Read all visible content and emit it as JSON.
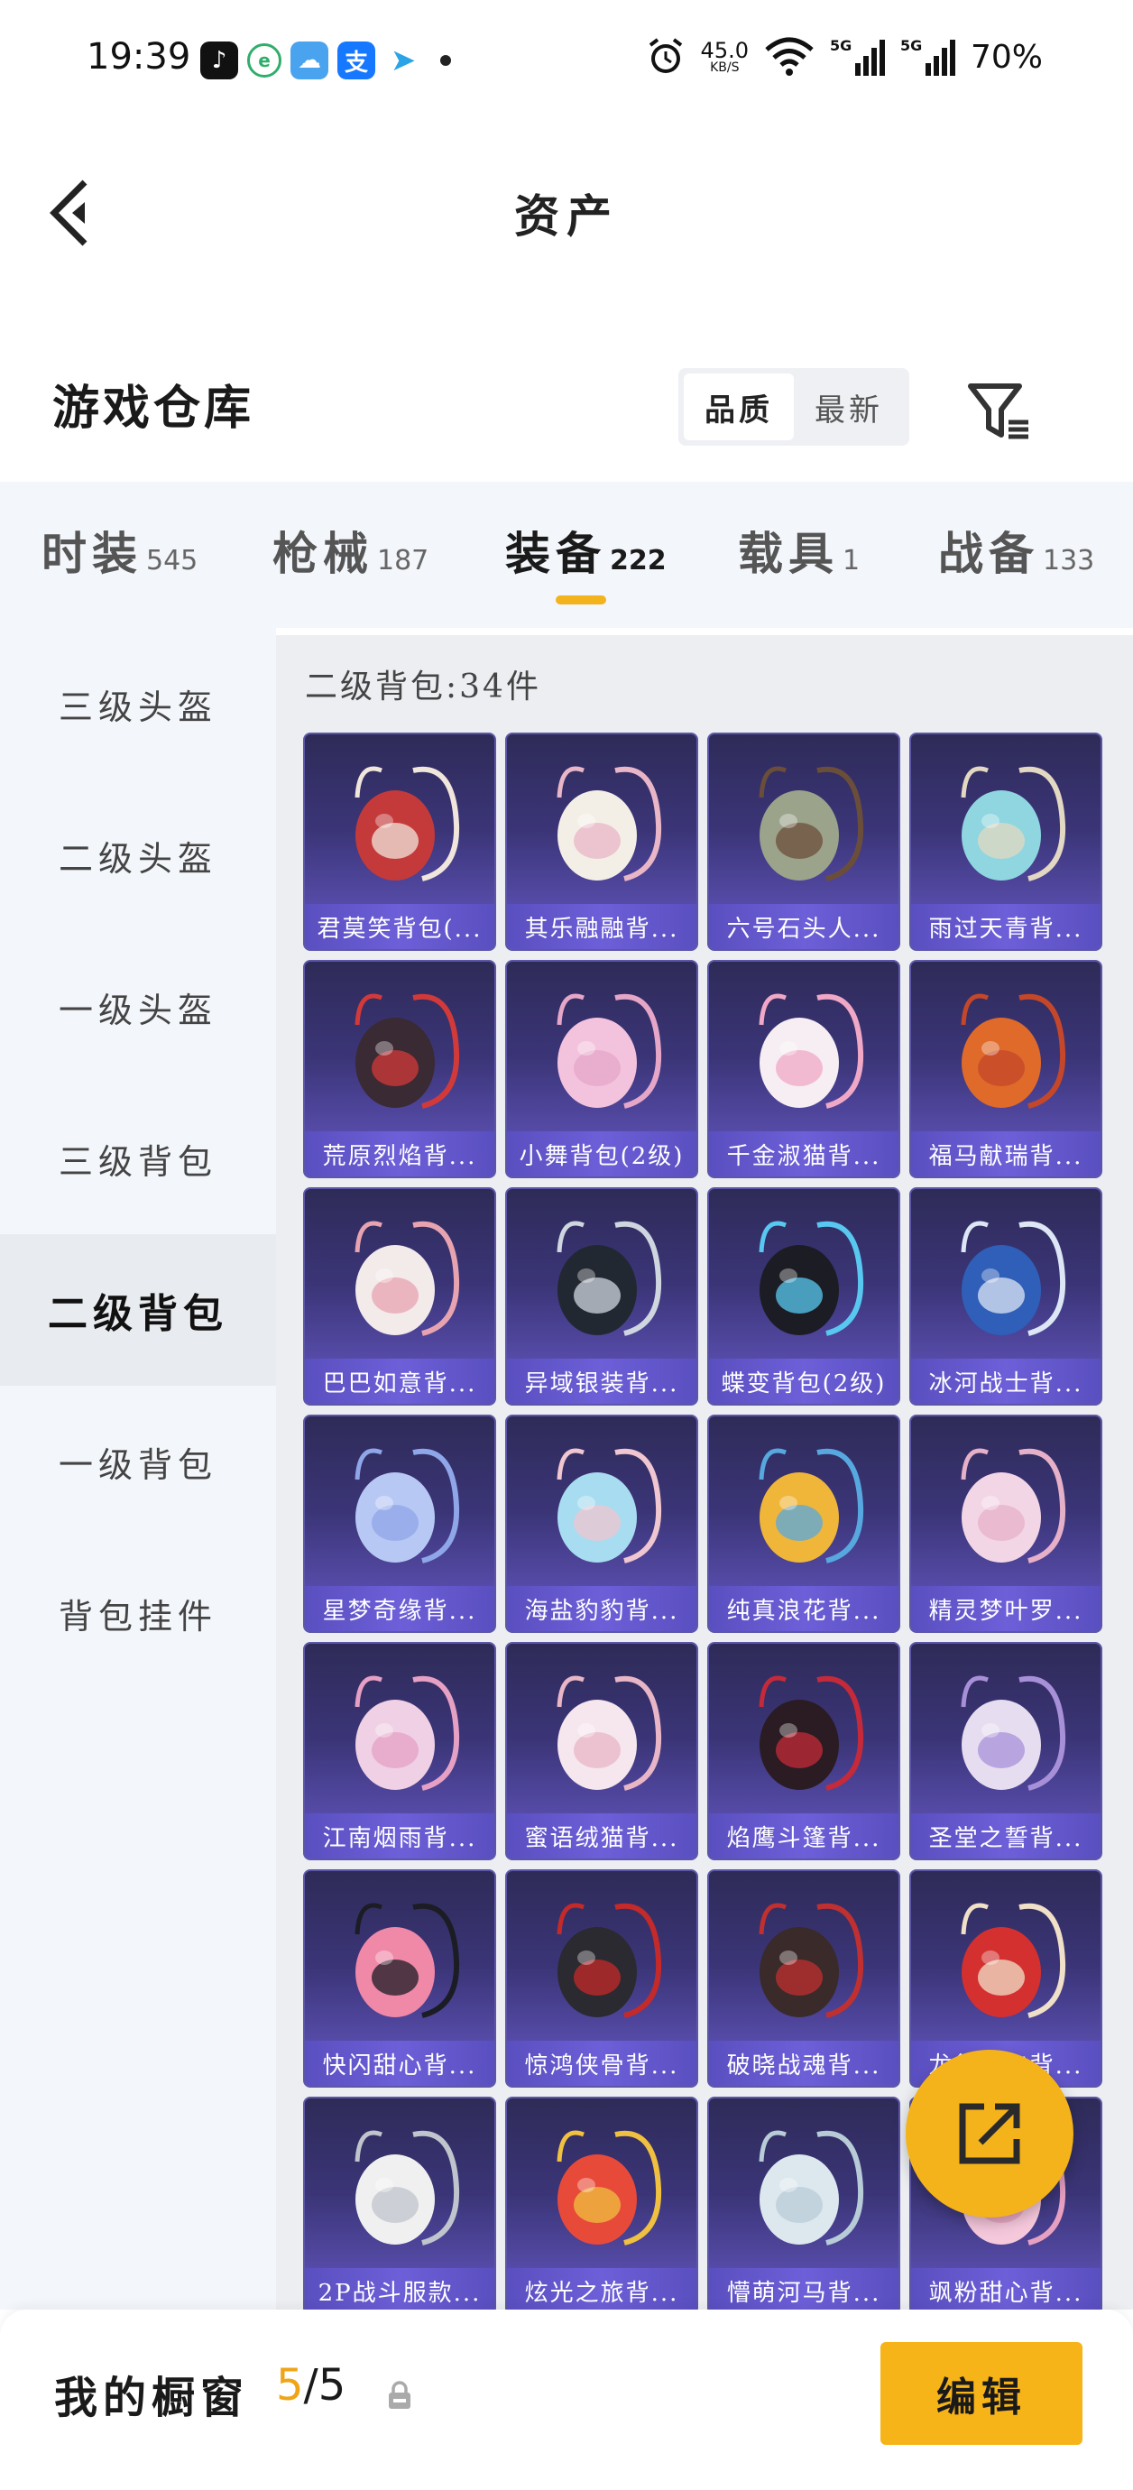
{
  "status_bar": {
    "time": "19:39",
    "net_speed": "45.0",
    "net_unit": "KB/S",
    "battery": "70%",
    "apps": [
      "tiktok-icon",
      "greenleaf-icon",
      "weather-icon",
      "alipay-icon",
      "telegram-icon"
    ]
  },
  "header": {
    "title": "资产"
  },
  "warehouse": {
    "title": "游戏仓库",
    "sort_options": [
      "品质",
      "最新"
    ],
    "active_sort": "品质"
  },
  "tabs": [
    {
      "label": "时装",
      "count": "545"
    },
    {
      "label": "枪械",
      "count": "187"
    },
    {
      "label": "装备",
      "count": "222"
    },
    {
      "label": "载具",
      "count": "1"
    },
    {
      "label": "战备",
      "count": "133"
    }
  ],
  "active_tab": "装备",
  "sidebar": {
    "items": [
      "三级头盔",
      "二级头盔",
      "一级头盔",
      "三级背包",
      "二级背包",
      "一级背包",
      "背包挂件"
    ],
    "active": "二级背包"
  },
  "panel": {
    "title": "二级背包:34件",
    "items": [
      "君莫笑背包(...",
      "其乐融融背...",
      "六号石头人...",
      "雨过天青背...",
      "荒原烈焰背...",
      "小舞背包(2级)",
      "千金淑猫背...",
      "福马献瑞背...",
      "巴巴如意背...",
      "异域银装背...",
      "蝶变背包(2级)",
      "冰河战士背...",
      "星梦奇缘背...",
      "海盐豹豹背...",
      "纯真浪花背...",
      "精灵梦叶罗...",
      "江南烟雨背...",
      "蜜语绒猫背...",
      "焰鹰斗篷背...",
      "圣堂之誓背...",
      "快闪甜心背...",
      "惊鸿侠骨背...",
      "破晓战魂背...",
      "龙行背包背...",
      "2P战斗服款...",
      "炫光之旅背...",
      "懵萌河马背...",
      "飒粉甜心背..."
    ]
  },
  "bottom_bar": {
    "label": "我的橱窗",
    "current": "5",
    "total": "/5",
    "edit_label": "编辑"
  },
  "colors": {
    "accent": "#f4b31a",
    "card_bg": "#3b3578",
    "caption_bg": "#6d5fd8"
  }
}
